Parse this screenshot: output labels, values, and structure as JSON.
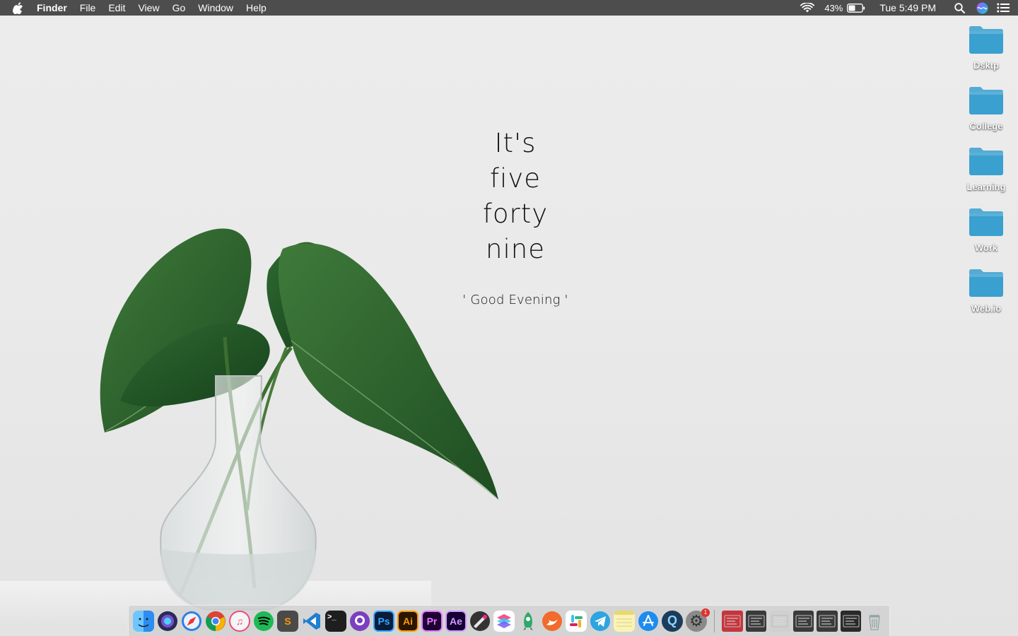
{
  "menubar": {
    "app_name": "Finder",
    "menus": [
      "File",
      "Edit",
      "View",
      "Go",
      "Window",
      "Help"
    ],
    "battery_percent": "43%",
    "clock": "Tue 5:49 PM"
  },
  "widget": {
    "lines": [
      "It's",
      "five",
      "forty",
      "nine"
    ],
    "greeting": "' Good Evening '"
  },
  "desktop": {
    "folders": [
      "Dsktp",
      "College",
      "Learning",
      "Work",
      "Web.io"
    ],
    "folder_color": "#3aa0cf"
  },
  "dock": {
    "apps": [
      {
        "name": "finder",
        "text": "",
        "bg": "#2d8df0",
        "running": true
      },
      {
        "name": "siri",
        "text": "",
        "bg": "#2a2a55",
        "running": false
      },
      {
        "name": "safari",
        "text": "",
        "bg": "#2f7fe6",
        "running": false
      },
      {
        "name": "chrome",
        "text": "",
        "bg": "#ffffff",
        "running": true
      },
      {
        "name": "itunes",
        "text": "♫",
        "bg": "#f5f5f5",
        "running": true
      },
      {
        "name": "spotify",
        "text": "",
        "bg": "#1db954",
        "running": false
      },
      {
        "name": "sublime-text",
        "text": "S",
        "bg": "#4a4a4a",
        "running": true
      },
      {
        "name": "vscode",
        "text": "",
        "bg": "#1f7fd1",
        "running": false
      },
      {
        "name": "terminal",
        "text": ">_",
        "bg": "#1e1e1e",
        "running": true
      },
      {
        "name": "github-desktop",
        "text": "",
        "bg": "#7b3fbf",
        "running": true
      },
      {
        "name": "photoshop",
        "text": "Ps",
        "bg": "#0a1c3a",
        "running": true
      },
      {
        "name": "illustrator",
        "text": "Ai",
        "bg": "#2a1600",
        "running": true
      },
      {
        "name": "premiere",
        "text": "Pr",
        "bg": "#1f0033",
        "running": true
      },
      {
        "name": "after-effects",
        "text": "Ae",
        "bg": "#140033",
        "running": false
      },
      {
        "name": "pixelmator",
        "text": "",
        "bg": "#3a3a3a",
        "running": false
      },
      {
        "name": "sketchbook",
        "text": "",
        "bg": "#ffffff",
        "running": false
      },
      {
        "name": "rocket-typist",
        "text": "",
        "bg": "#ffffff",
        "running": false
      },
      {
        "name": "swift-playgrounds",
        "text": "",
        "bg": "#f26a2c",
        "running": true
      },
      {
        "name": "slack",
        "text": "",
        "bg": "#ffffff",
        "running": false
      },
      {
        "name": "telegram",
        "text": "",
        "bg": "#2ca5e0",
        "running": false
      },
      {
        "name": "notes",
        "text": "",
        "bg": "#fbf3b3",
        "running": false
      },
      {
        "name": "app-store",
        "text": "",
        "bg": "#1d8cf0",
        "running": false
      },
      {
        "name": "quicktime",
        "text": "Q",
        "bg": "#1b3c5a",
        "running": false
      },
      {
        "name": "system-preferences",
        "text": "⚙",
        "bg": "#8a8a8a",
        "running": false,
        "badge": "1"
      }
    ],
    "docs": [
      {
        "name": "dock-stack-1",
        "bg": "#c7353b"
      },
      {
        "name": "dock-stack-2",
        "bg": "#3a3a3a"
      },
      {
        "name": "dock-stack-3",
        "bg": "#d0d0d0"
      },
      {
        "name": "dock-stack-4",
        "bg": "#3a3a3a"
      },
      {
        "name": "dock-stack-5",
        "bg": "#3a3a3a"
      },
      {
        "name": "dock-stack-6",
        "bg": "#2a2a2a"
      }
    ]
  }
}
